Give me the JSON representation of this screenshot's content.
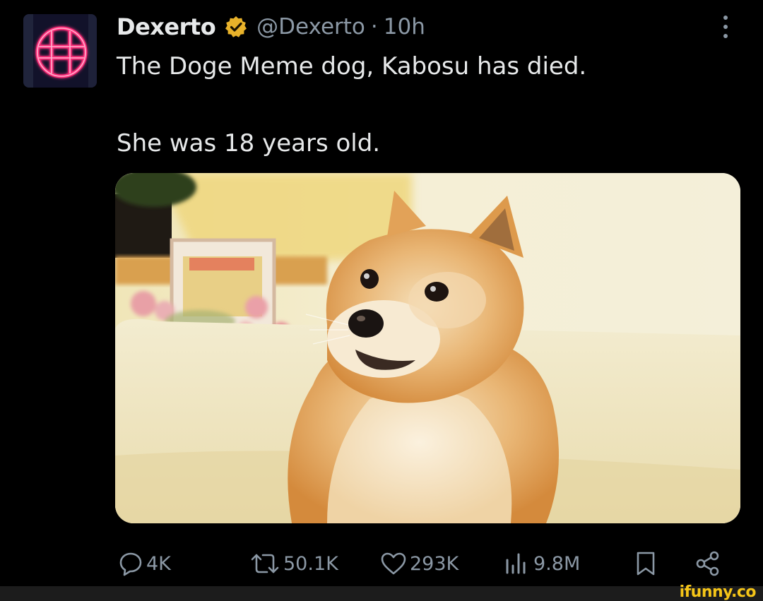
{
  "tweet": {
    "author": {
      "display_name": "Dexerto",
      "handle": "@Dexerto",
      "separator": "·",
      "time": "10h",
      "verified": true,
      "verified_color": "#e8b22a",
      "avatar_icon": "dexerto-logo-icon"
    },
    "text_lines": [
      "The Doge Meme dog, Kabosu has died.",
      "She was 18 years old."
    ],
    "media": {
      "icon": "shiba-inu-photo"
    },
    "actions": {
      "replies": "4K",
      "reposts": "50.1K",
      "likes": "293K",
      "views": "9.8M"
    }
  },
  "watermark": "ifunny.co",
  "colors": {
    "background": "#000000",
    "text_primary": "#e7e9ea",
    "text_secondary": "#8b98a5",
    "watermark": "#f5c518"
  }
}
